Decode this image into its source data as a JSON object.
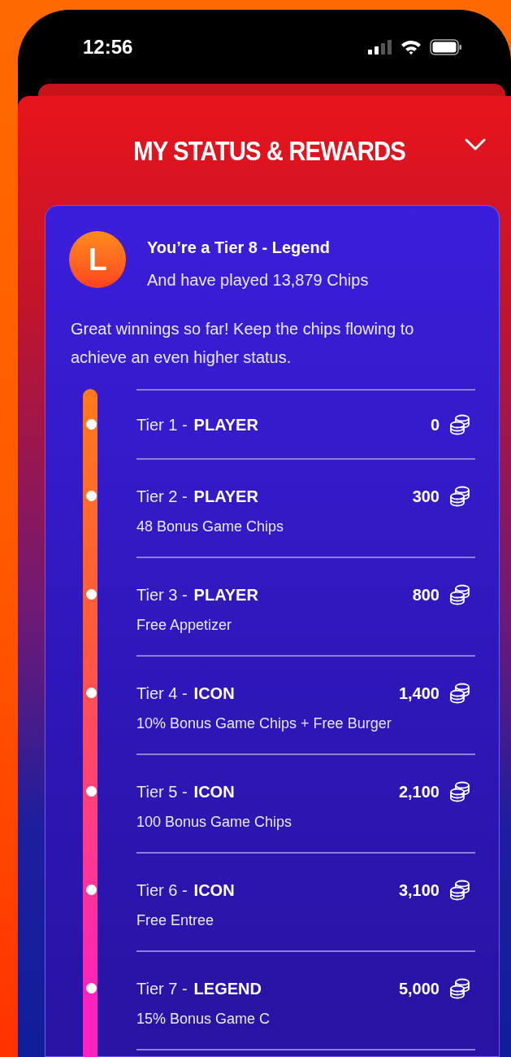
{
  "status_bar": {
    "time": "12:56"
  },
  "header": {
    "title": "MY STATUS & REWARDS",
    "expanded": true
  },
  "summary": {
    "avatar_letter": "L",
    "tier_title": "You’re a Tier 8 - Legend",
    "played": "And have played 13,879 Chips",
    "message": "Great winnings so far! Keep the chips flowing to achieve an even higher status."
  },
  "tiers": [
    {
      "label": "Tier 1 -",
      "level_name": "PLAYER",
      "chips": "0"
    },
    {
      "label": "Tier 2 -",
      "level_name": "PLAYER",
      "chips": "300",
      "reward": "48 Bonus Game Chips"
    },
    {
      "label": "Tier 3 -",
      "level_name": "PLAYER",
      "chips": "800",
      "reward": "Free Appetizer"
    },
    {
      "label": "Tier 4 -",
      "level_name": "ICON",
      "chips": "1,400",
      "reward": "10% Bonus Game Chips + Free Burger"
    },
    {
      "label": "Tier 5 -",
      "level_name": "ICON",
      "chips": "2,100",
      "reward": "100 Bonus Game Chips"
    },
    {
      "label": "Tier 6 -",
      "level_name": "ICON",
      "chips": "3,100",
      "reward": "Free Entree"
    },
    {
      "label": "Tier 7 -",
      "level_name": "LEGEND",
      "chips": "5,000",
      "reward": "15% Bonus Game C"
    }
  ]
}
